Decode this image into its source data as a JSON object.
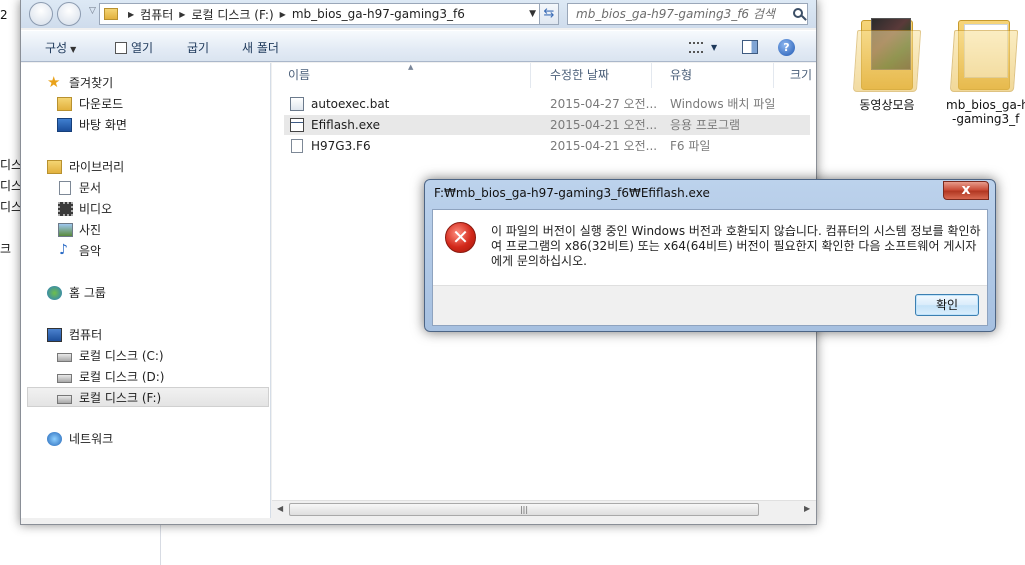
{
  "desktop": {
    "left_fragments": [
      "2",
      "디스",
      "디스",
      "디스",
      "크"
    ],
    "icons": [
      {
        "label": "동영상모음"
      },
      {
        "label_line1": "mb_bios_ga-h",
        "label_line2": "-gaming3_f"
      }
    ]
  },
  "explorer": {
    "breadcrumb": [
      "컴퓨터",
      "로컬 디스크 (F:)",
      "mb_bios_ga-h97-gaming3_f6"
    ],
    "search_placeholder": "mb_bios_ga-h97-gaming3_f6 검색",
    "toolbar": {
      "organize": "구성",
      "open": "열기",
      "burn": "굽기",
      "new_folder": "새 폴더"
    },
    "nav": {
      "favorites": "즐겨찾기",
      "downloads": "다운로드",
      "desktop": "바탕 화면",
      "libraries": "라이브러리",
      "documents": "문서",
      "videos": "비디오",
      "pictures": "사진",
      "music": "음악",
      "homegroup": "홈 그룹",
      "computer": "컴퓨터",
      "disk_c": "로컬 디스크 (C:)",
      "disk_d": "로컬 디스크 (D:)",
      "disk_f": "로컬 디스크 (F:)",
      "network": "네트워크"
    },
    "columns": {
      "name": "이름",
      "date": "수정한 날짜",
      "type": "유형",
      "size": "크기"
    },
    "files": [
      {
        "name": "autoexec.bat",
        "date": "2015-04-27 오전...",
        "type": "Windows 배치 파일"
      },
      {
        "name": "Efiflash.exe",
        "date": "2015-04-21 오전...",
        "type": "응용 프로그램"
      },
      {
        "name": "H97G3.F6",
        "date": "2015-04-21 오전...",
        "type": "F6 파일"
      }
    ]
  },
  "dialog": {
    "title": "F:₩mb_bios_ga-h97-gaming3_f6₩Efiflash.exe",
    "message": "이 파일의 버전이 실행 중인 Windows 버전과 호환되지 않습니다. 컴퓨터의 시스템 정보를 확인하여 프로그램의 x86(32비트) 또는 x64(64비트) 버전이 필요한지 확인한 다음 소프트웨어 게시자에게 문의하십시오.",
    "ok": "확인",
    "close_glyph": "x"
  }
}
